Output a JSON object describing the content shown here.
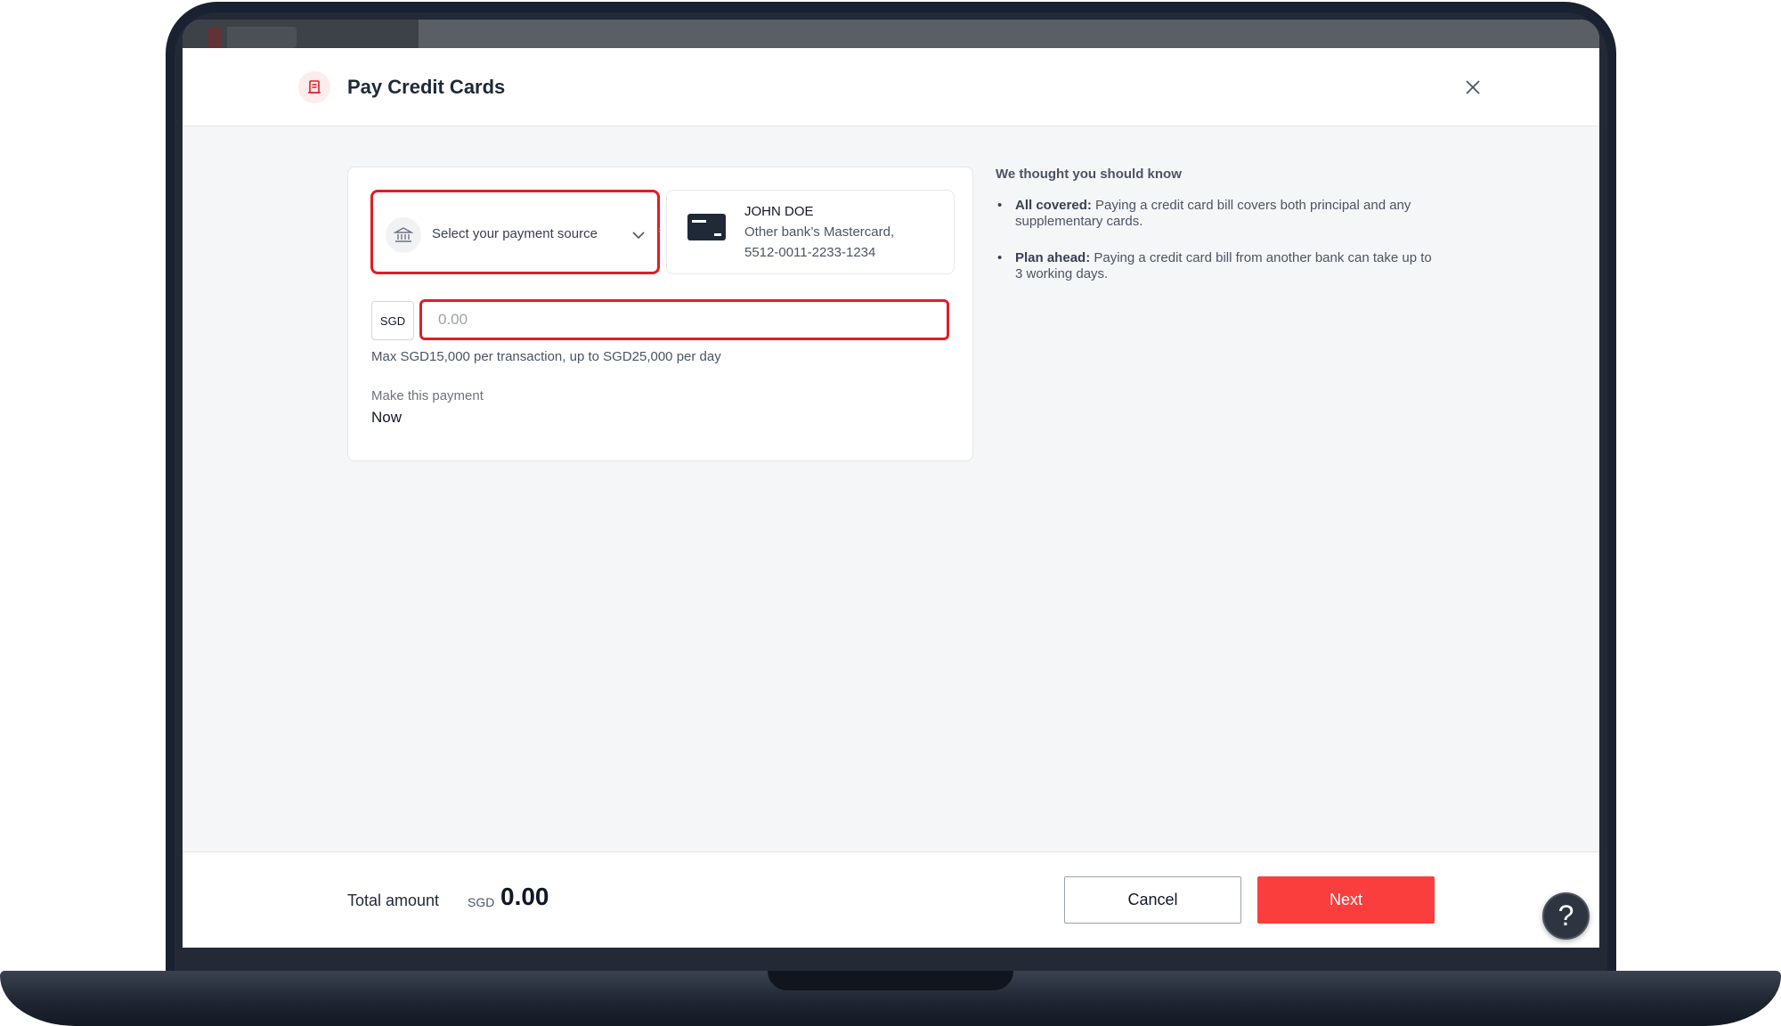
{
  "modal": {
    "title": "Pay Credit Cards",
    "close_icon": "close-icon",
    "title_icon": "bill-icon"
  },
  "payment_source": {
    "placeholder": "Select your payment source",
    "icon": "bank-icon"
  },
  "destination": {
    "name": "JOHN DOE",
    "line1": "Other bank’s Mastercard,",
    "line2": "5512-0011-2233-1234",
    "icon": "credit-card-icon"
  },
  "amount": {
    "currency": "SGD",
    "placeholder": "0.00",
    "value": "",
    "limit_hint": "Max SGD15,000 per transaction, up to SGD25,000 per day"
  },
  "schedule": {
    "label": "Make this payment",
    "value": "Now"
  },
  "info": {
    "title": "We thought you should know",
    "items": [
      {
        "heading": "All covered:",
        "text": " Paying a credit card bill covers both principal and any supplementary cards."
      },
      {
        "heading": "Plan ahead:",
        "text": " Paying a credit card bill from another bank can take up to 3 working days."
      }
    ]
  },
  "footer": {
    "total_label": "Total amount",
    "total_currency": "SGD",
    "total_value": "0.00",
    "cancel_label": "Cancel",
    "next_label": "Next",
    "help_label": "?"
  },
  "colors": {
    "accent_red": "#fa3e3e",
    "highlight_red": "#e11d24"
  }
}
